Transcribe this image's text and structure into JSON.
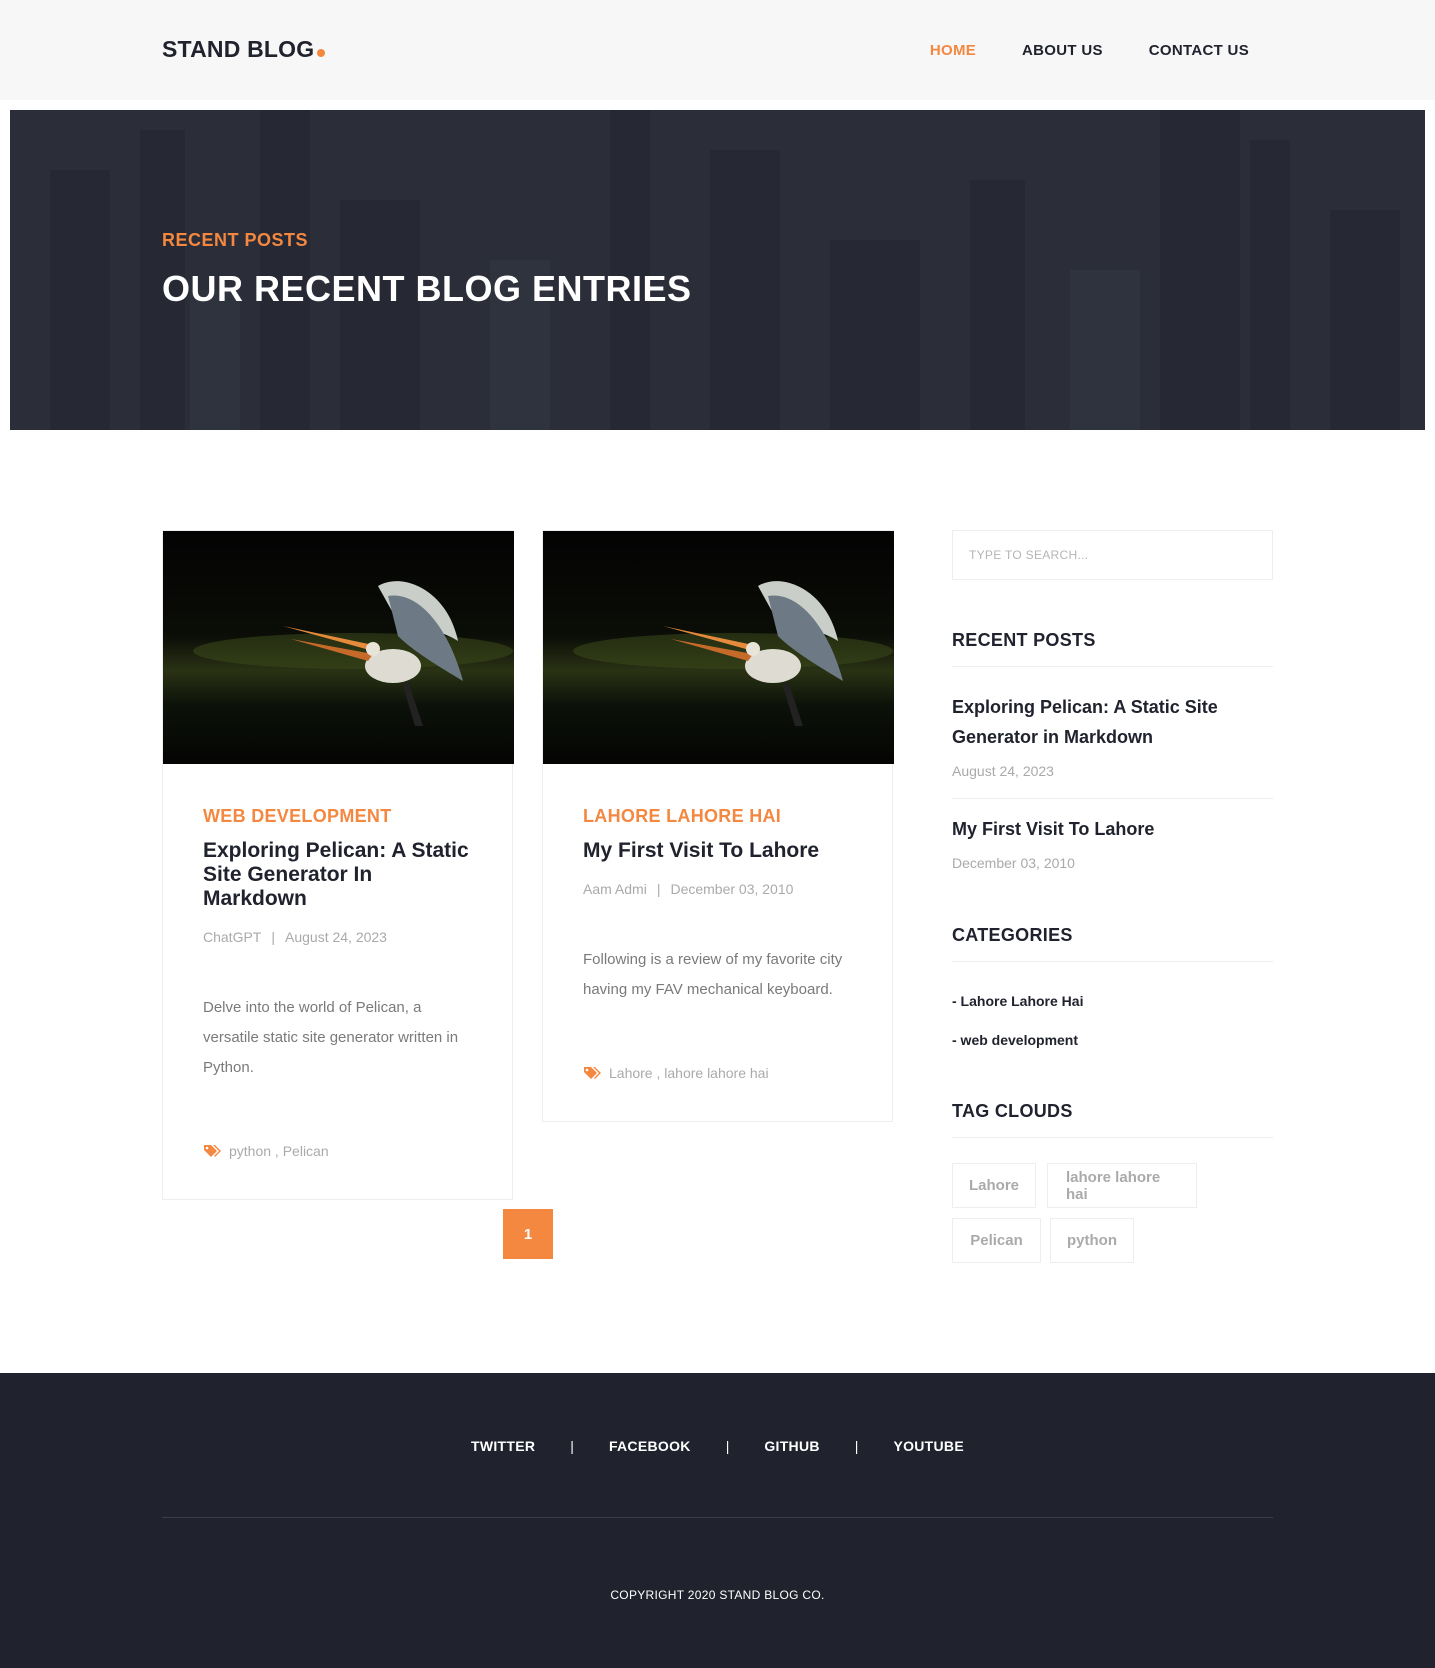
{
  "brand": {
    "name": "STAND BLOG",
    "accent": "#f48840",
    "dark": "#20232e"
  },
  "nav": {
    "home": "HOME",
    "about": "ABOUT US",
    "contact": "CONTACT US"
  },
  "hero": {
    "label": "RECENT POSTS",
    "title": "OUR RECENT BLOG ENTRIES"
  },
  "posts": [
    {
      "category": "WEB DEVELOPMENT",
      "title": "Exploring Pelican: A Static Site Generator In Markdown",
      "author": "ChatGPT",
      "date": "August 24, 2023",
      "excerpt": "Delve into the world of Pelican, a versatile static site generator written in Python.",
      "tags": "python , Pelican",
      "image_icon": "pelican-photo"
    },
    {
      "category": "LAHORE LAHORE HAI",
      "title": "My First Visit To Lahore",
      "author": "Aam Admi",
      "date": "December 03, 2010",
      "excerpt": "Following is a review of my favorite city having my FAV mechanical keyboard.",
      "tags": "Lahore , lahore lahore hai",
      "image_icon": "pelican-photo"
    }
  ],
  "pagination": {
    "current": "1"
  },
  "sidebar": {
    "search_placeholder": "TYPE TO SEARCH...",
    "recent_heading": "RECENT POSTS",
    "recent": [
      {
        "title": "Exploring Pelican: A Static Site Generator in Markdown",
        "date": "August 24, 2023"
      },
      {
        "title": "My First Visit To Lahore",
        "date": "December 03, 2010"
      }
    ],
    "categories_heading": "CATEGORIES",
    "categories": [
      "- Lahore Lahore Hai",
      "- web development"
    ],
    "tags_heading": "TAG CLOUDS",
    "tags": [
      "Lahore",
      "lahore lahore hai",
      "Pelican",
      "python"
    ]
  },
  "footer": {
    "social": [
      "TWITTER",
      "FACEBOOK",
      "GITHUB",
      "YOUTUBE"
    ],
    "separator": "|",
    "copyright": "COPYRIGHT 2020 STAND BLOG CO."
  }
}
